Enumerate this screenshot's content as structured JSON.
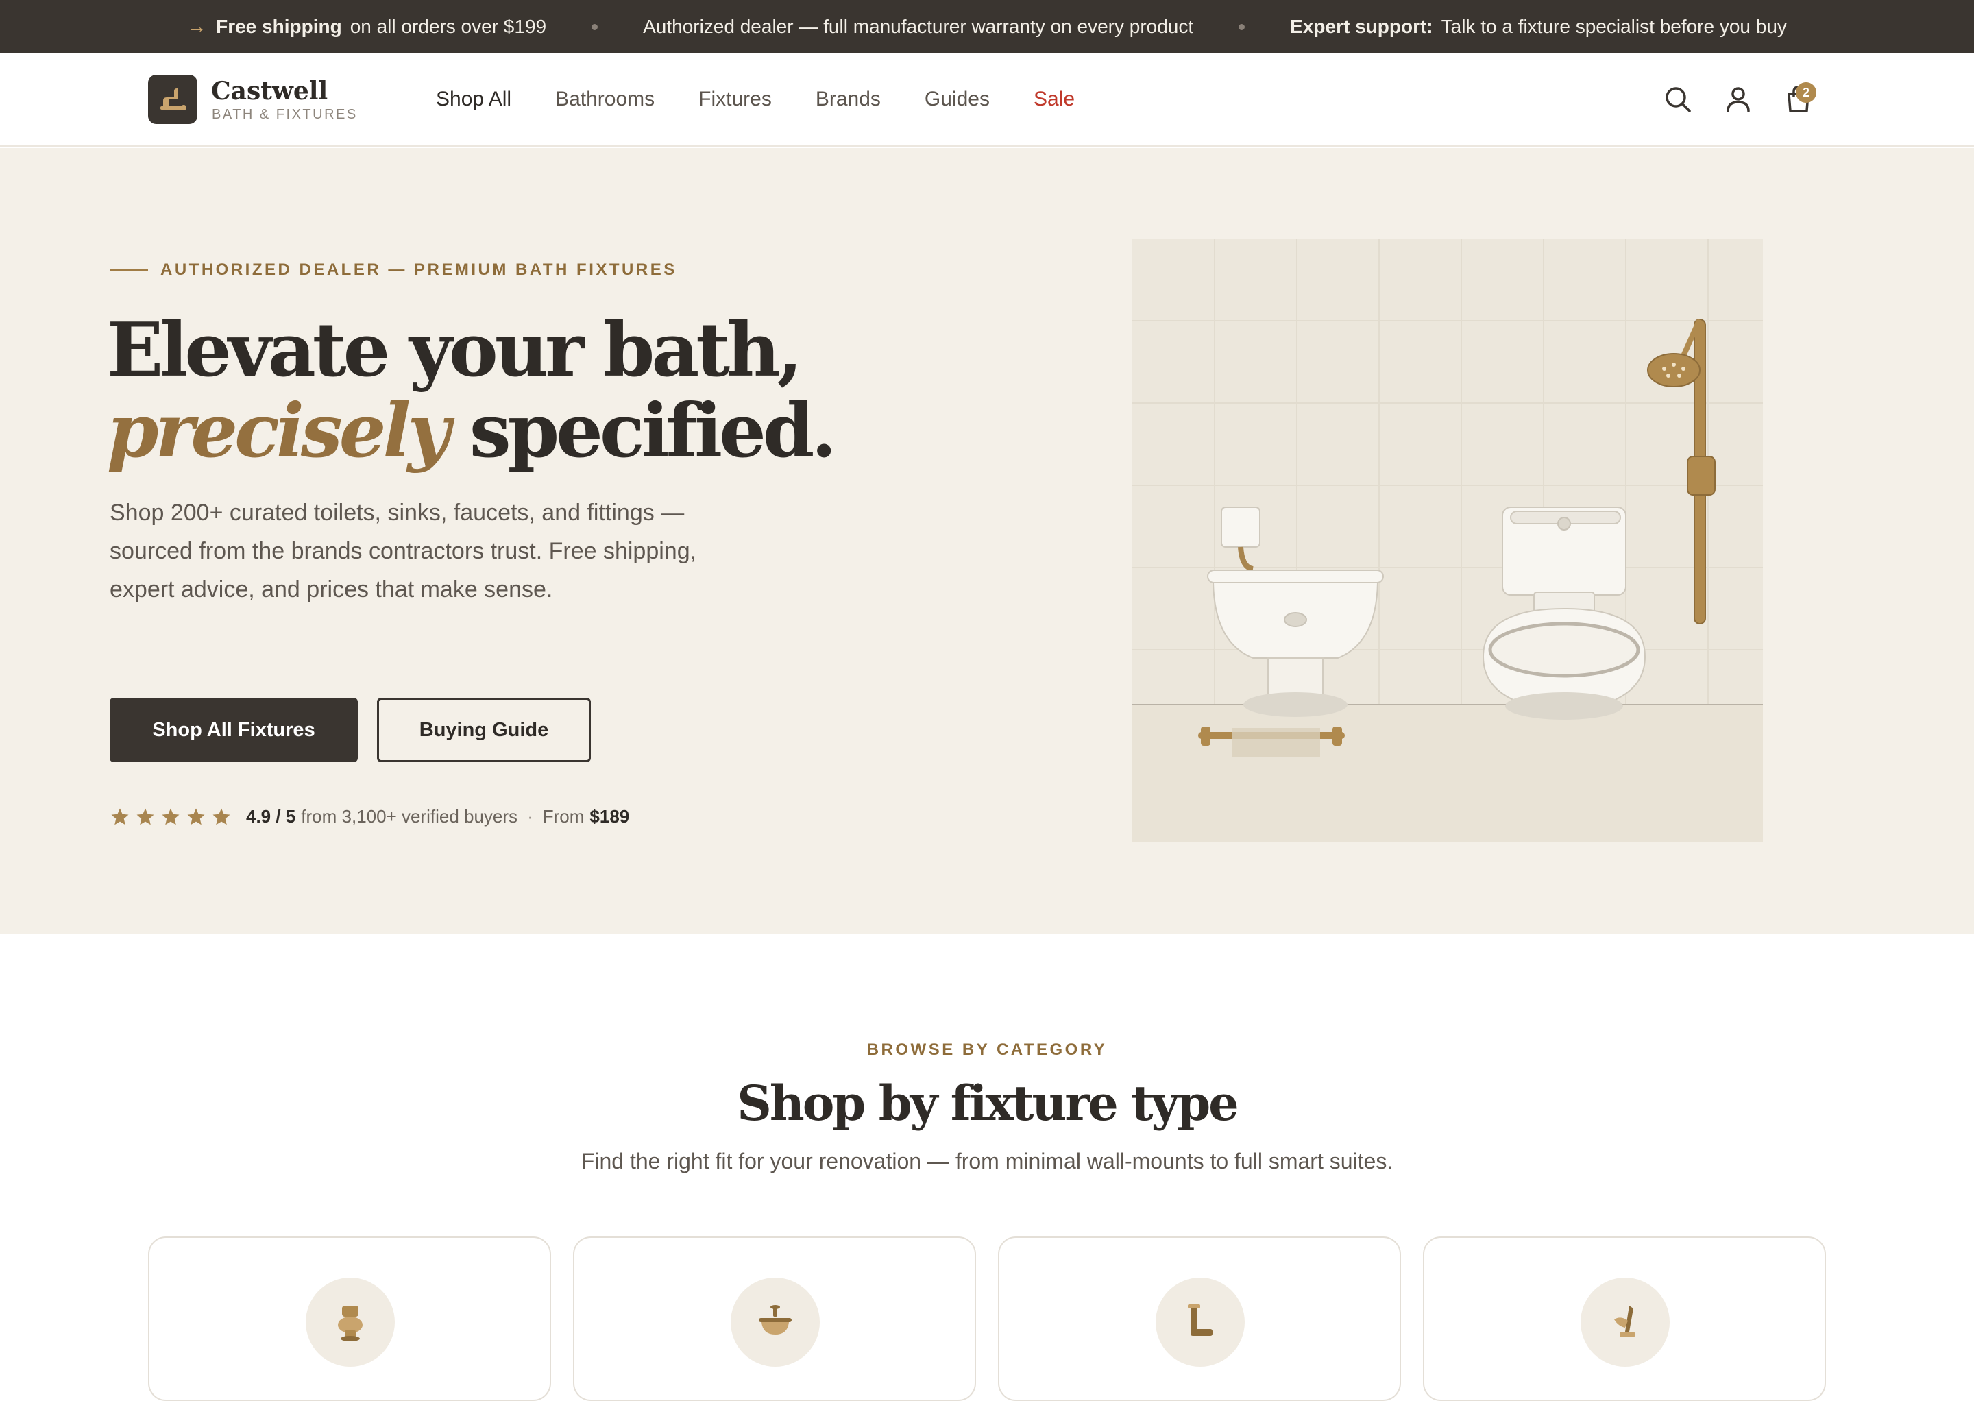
{
  "announcement": {
    "items": [
      {
        "bold": "Free shipping",
        "text": "on all orders over $199"
      },
      {
        "bold": "",
        "text": "Authorized dealer — full manufacturer warranty on every product"
      },
      {
        "bold": "Expert support:",
        "text": "Talk to a fixture specialist before you buy"
      }
    ]
  },
  "header": {
    "brand_name": "Castwell",
    "brand_sub": "BATH & FIXTURES",
    "nav": [
      "Shop All",
      "Bathrooms",
      "Fixtures",
      "Brands",
      "Guides",
      "Sale"
    ],
    "cart_count": "2",
    "icons": [
      "search-icon",
      "user-icon",
      "cart-icon"
    ]
  },
  "hero": {
    "eyebrow": "AUTHORIZED DEALER — PREMIUM BATH FIXTURES",
    "title_line1": "Elevate your bath,",
    "title_em": "precisely",
    "title_rest": "specified.",
    "lead": "Shop 200+ curated toilets, sinks, faucets, and fittings — sourced from the brands contractors trust. Free shipping, expert advice, and prices that make sense.",
    "primary_button": "Shop All Fixtures",
    "secondary_button": "Buying Guide",
    "rating_value": "4.9 / 5",
    "rating_text": "from 3,100+ verified buyers",
    "from_label": "From",
    "from_price": "$189",
    "stars": 5
  },
  "categories": {
    "eyebrow": "BROWSE BY CATEGORY",
    "title": "Shop by fixture type",
    "subtitle": "Find the right fit for your renovation — from minimal wall-mounts to full smart suites.",
    "cards": [
      {
        "icon": "toilet-icon"
      },
      {
        "icon": "sink-icon"
      },
      {
        "icon": "faucet-icon"
      },
      {
        "icon": "shower-icon"
      }
    ]
  },
  "colors": {
    "dark": "#3a3530",
    "accent": "#94703f",
    "hero_bg": "#f4f0e8",
    "sale": "#c0392b"
  }
}
